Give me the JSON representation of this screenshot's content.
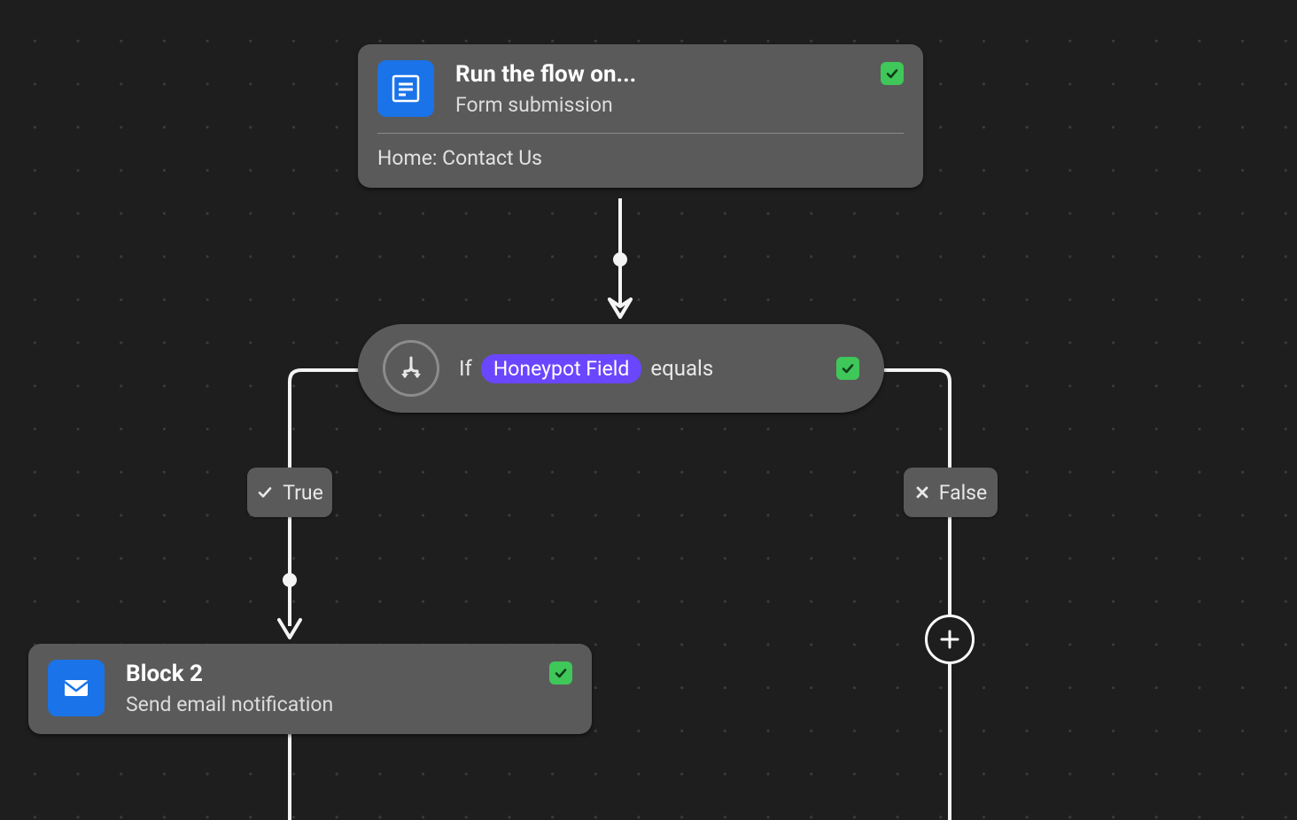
{
  "trigger": {
    "title": "Run the flow on...",
    "subtitle": "Form submission",
    "detail": "Home: Contact Us",
    "icon": "form-icon",
    "status_ok": true
  },
  "condition": {
    "prefix": "If",
    "token": "Honeypot Field",
    "operator": "equals",
    "icon": "branch-icon",
    "status_ok": true
  },
  "branches": {
    "true_label": "True",
    "false_label": "False"
  },
  "action": {
    "title": "Block 2",
    "subtitle": "Send email notification",
    "icon": "mail-icon",
    "status_ok": true
  },
  "add_button": {
    "icon": "plus-icon"
  }
}
